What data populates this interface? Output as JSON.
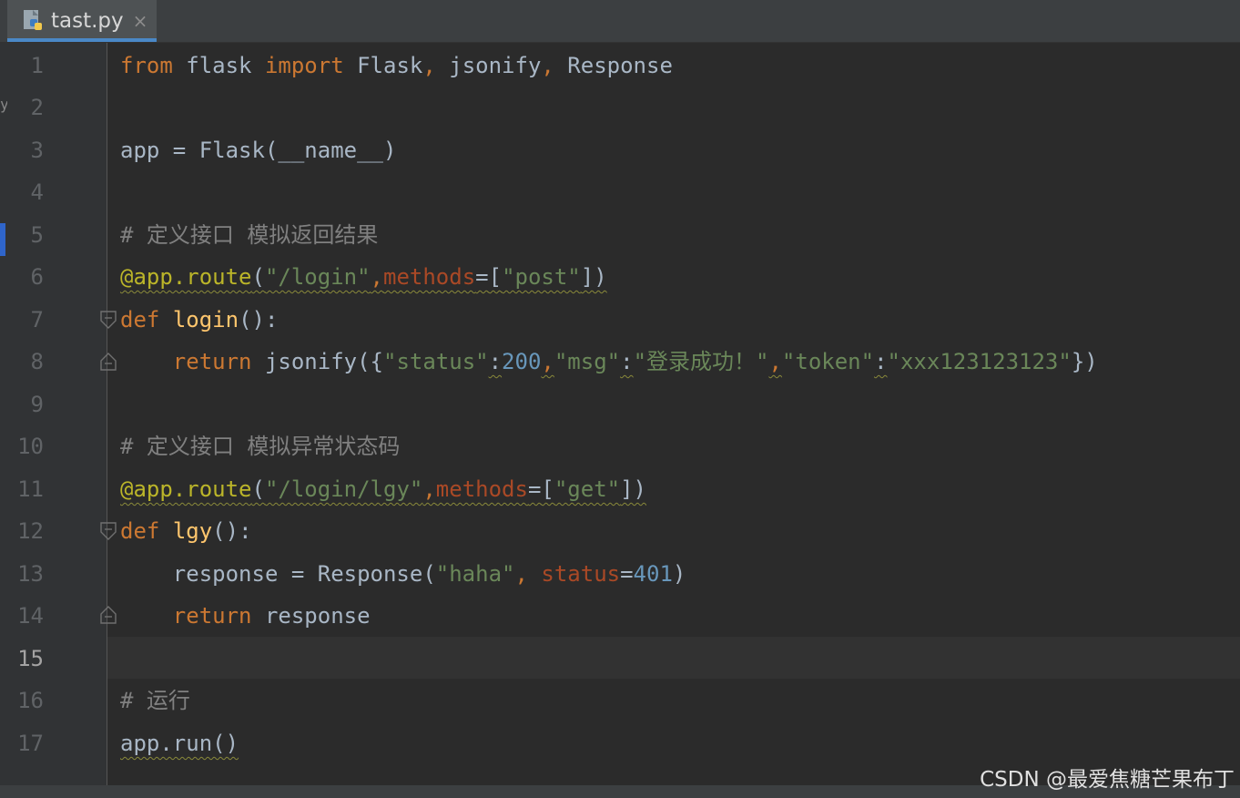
{
  "tab": {
    "filename": "tast.py",
    "close": "×",
    "icon": "python-file-icon"
  },
  "left_stub": "y",
  "lines": {
    "1": {
      "number": "1"
    },
    "2": {
      "number": "2"
    },
    "3": {
      "number": "3"
    },
    "4": {
      "number": "4"
    },
    "5": {
      "number": "5"
    },
    "6": {
      "number": "6"
    },
    "7": {
      "number": "7"
    },
    "8": {
      "number": "8"
    },
    "9": {
      "number": "9"
    },
    "10": {
      "number": "10"
    },
    "11": {
      "number": "11"
    },
    "12": {
      "number": "12"
    },
    "13": {
      "number": "13"
    },
    "14": {
      "number": "14"
    },
    "15": {
      "number": "15"
    },
    "16": {
      "number": "16"
    },
    "17": {
      "number": "17"
    }
  },
  "code": {
    "l1": {
      "from": "from",
      "t1": " flask ",
      "import": "import",
      "t2": " Flask",
      "c1": ",",
      "t3": " jsonify",
      "c2": ",",
      "t4": " Response"
    },
    "l3": {
      "text": "app = Flask(__name__)"
    },
    "l5": {
      "comment": "# 定义接口 模拟返回结果"
    },
    "l6": {
      "deco": "@app.route",
      "p1": "(",
      "s1": "\"/login\"",
      "c1": ",",
      "param": "methods",
      "eq": "=",
      "b1": "[",
      "s2": "\"post\"",
      "b2": "])"
    },
    "l7": {
      "def": "def",
      "sp": " ",
      "name": "login",
      "rest": "():"
    },
    "l8": {
      "ind": "    ",
      "ret": "return",
      "t1": " jsonify({",
      "s1": "\"status\"",
      "col1": ":",
      "n1": "200",
      "c1": ",",
      "s2": "\"msg\"",
      "col2": ":",
      "s3": "\"登录成功！\"",
      "c2": ",",
      "s4": "\"token\"",
      "col3": ":",
      "s5": "\"xxx123123123\"",
      "end": "})"
    },
    "l10": {
      "comment": "# 定义接口 模拟异常状态码"
    },
    "l11": {
      "deco": "@app.route",
      "p1": "(",
      "s1": "\"/login/lgy\"",
      "c1": ",",
      "param": "methods",
      "eq": "=",
      "b1": "[",
      "s2": "\"get\"",
      "b2": "])"
    },
    "l12": {
      "def": "def",
      "sp": " ",
      "name": "lgy",
      "rest": "():"
    },
    "l13": {
      "ind": "    ",
      "t1": "response = Response(",
      "s1": "\"haha\"",
      "c1": ", ",
      "param": "status",
      "eq": "=",
      "n1": "401",
      "end": ")"
    },
    "l14": {
      "ind": "    ",
      "ret": "return",
      "t1": " response"
    },
    "l16": {
      "comment": "# 运行"
    },
    "l17": {
      "text": "app.run()"
    }
  },
  "watermark": "CSDN @最爱焦糖芒果布丁",
  "colors": {
    "background": "#2b2b2b",
    "keyword": "#cc7832",
    "string": "#6a8759",
    "number": "#6897bb",
    "comment": "#808080",
    "decorator": "#bbb529",
    "function": "#ffc66d",
    "accent": "#4a88c7"
  }
}
